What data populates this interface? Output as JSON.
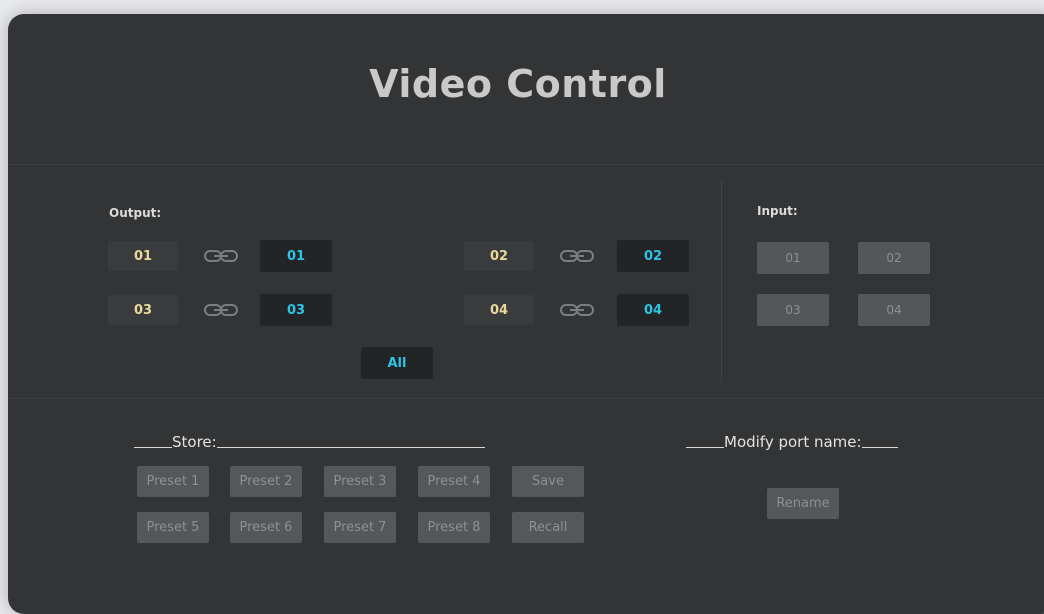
{
  "title": "Video Control",
  "output_label": "Output:",
  "input_label": "Input:",
  "outputs": [
    {
      "out": "01",
      "in": "01"
    },
    {
      "out": "02",
      "in": "02"
    },
    {
      "out": "03",
      "in": "03"
    },
    {
      "out": "04",
      "in": "04"
    }
  ],
  "all_label": "All",
  "inputs": [
    "01",
    "02",
    "03",
    "04"
  ],
  "store_label": "Store:",
  "presets": [
    "Preset 1",
    "Preset 2",
    "Preset 3",
    "Preset 4",
    "Preset 5",
    "Preset 6",
    "Preset 7",
    "Preset 8"
  ],
  "save_label": "Save",
  "recall_label": "Recall",
  "modify_label": "Modify port name:",
  "rename_label": "Rename",
  "icons": {
    "link": "link-icon"
  },
  "colors": {
    "accent": "#2ec4e6",
    "output_text": "#e8d89a",
    "panel_bg": "#333435"
  }
}
